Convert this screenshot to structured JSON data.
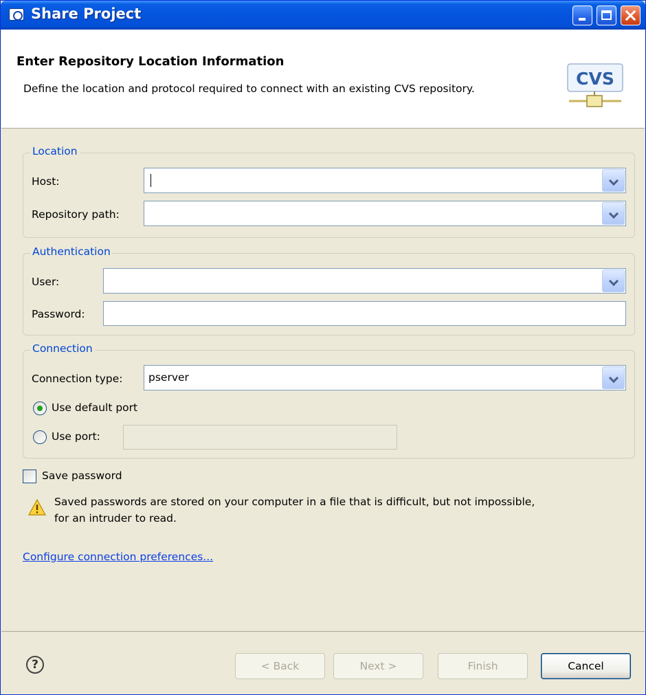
{
  "window": {
    "title": "Share Project"
  },
  "banner": {
    "title": "Enter Repository Location Information",
    "description": "Define the location and protocol required to connect with an existing CVS repository.",
    "icon": "cvs-repository-icon",
    "icon_text": "CVS"
  },
  "location": {
    "legend": "Location",
    "host_label": "Host:",
    "host_value": "",
    "path_label": "Repository path:",
    "path_value": ""
  },
  "authentication": {
    "legend": "Authentication",
    "user_label": "User:",
    "user_value": "",
    "password_label": "Password:",
    "password_value": ""
  },
  "connection": {
    "legend": "Connection",
    "type_label": "Connection type:",
    "type_value": "pserver",
    "default_port_label": "Use default port",
    "default_port_selected": true,
    "use_port_label": "Use port:",
    "port_value": ""
  },
  "save_password": {
    "label": "Save password",
    "checked": false,
    "warning": "Saved passwords are stored on your computer in a file that is difficult, but not impossible,",
    "warning_line2": "for an intruder to read."
  },
  "link": {
    "text": "Configure connection preferences..."
  },
  "footer": {
    "help": "?",
    "back": "< Back",
    "next": "Next >",
    "finish": "Finish",
    "cancel": "Cancel"
  },
  "colors": {
    "title_bar": "#0454dd",
    "dialog_bg": "#ece9d8",
    "legend_text": "#0046d5",
    "link": "#0b3ee6"
  }
}
